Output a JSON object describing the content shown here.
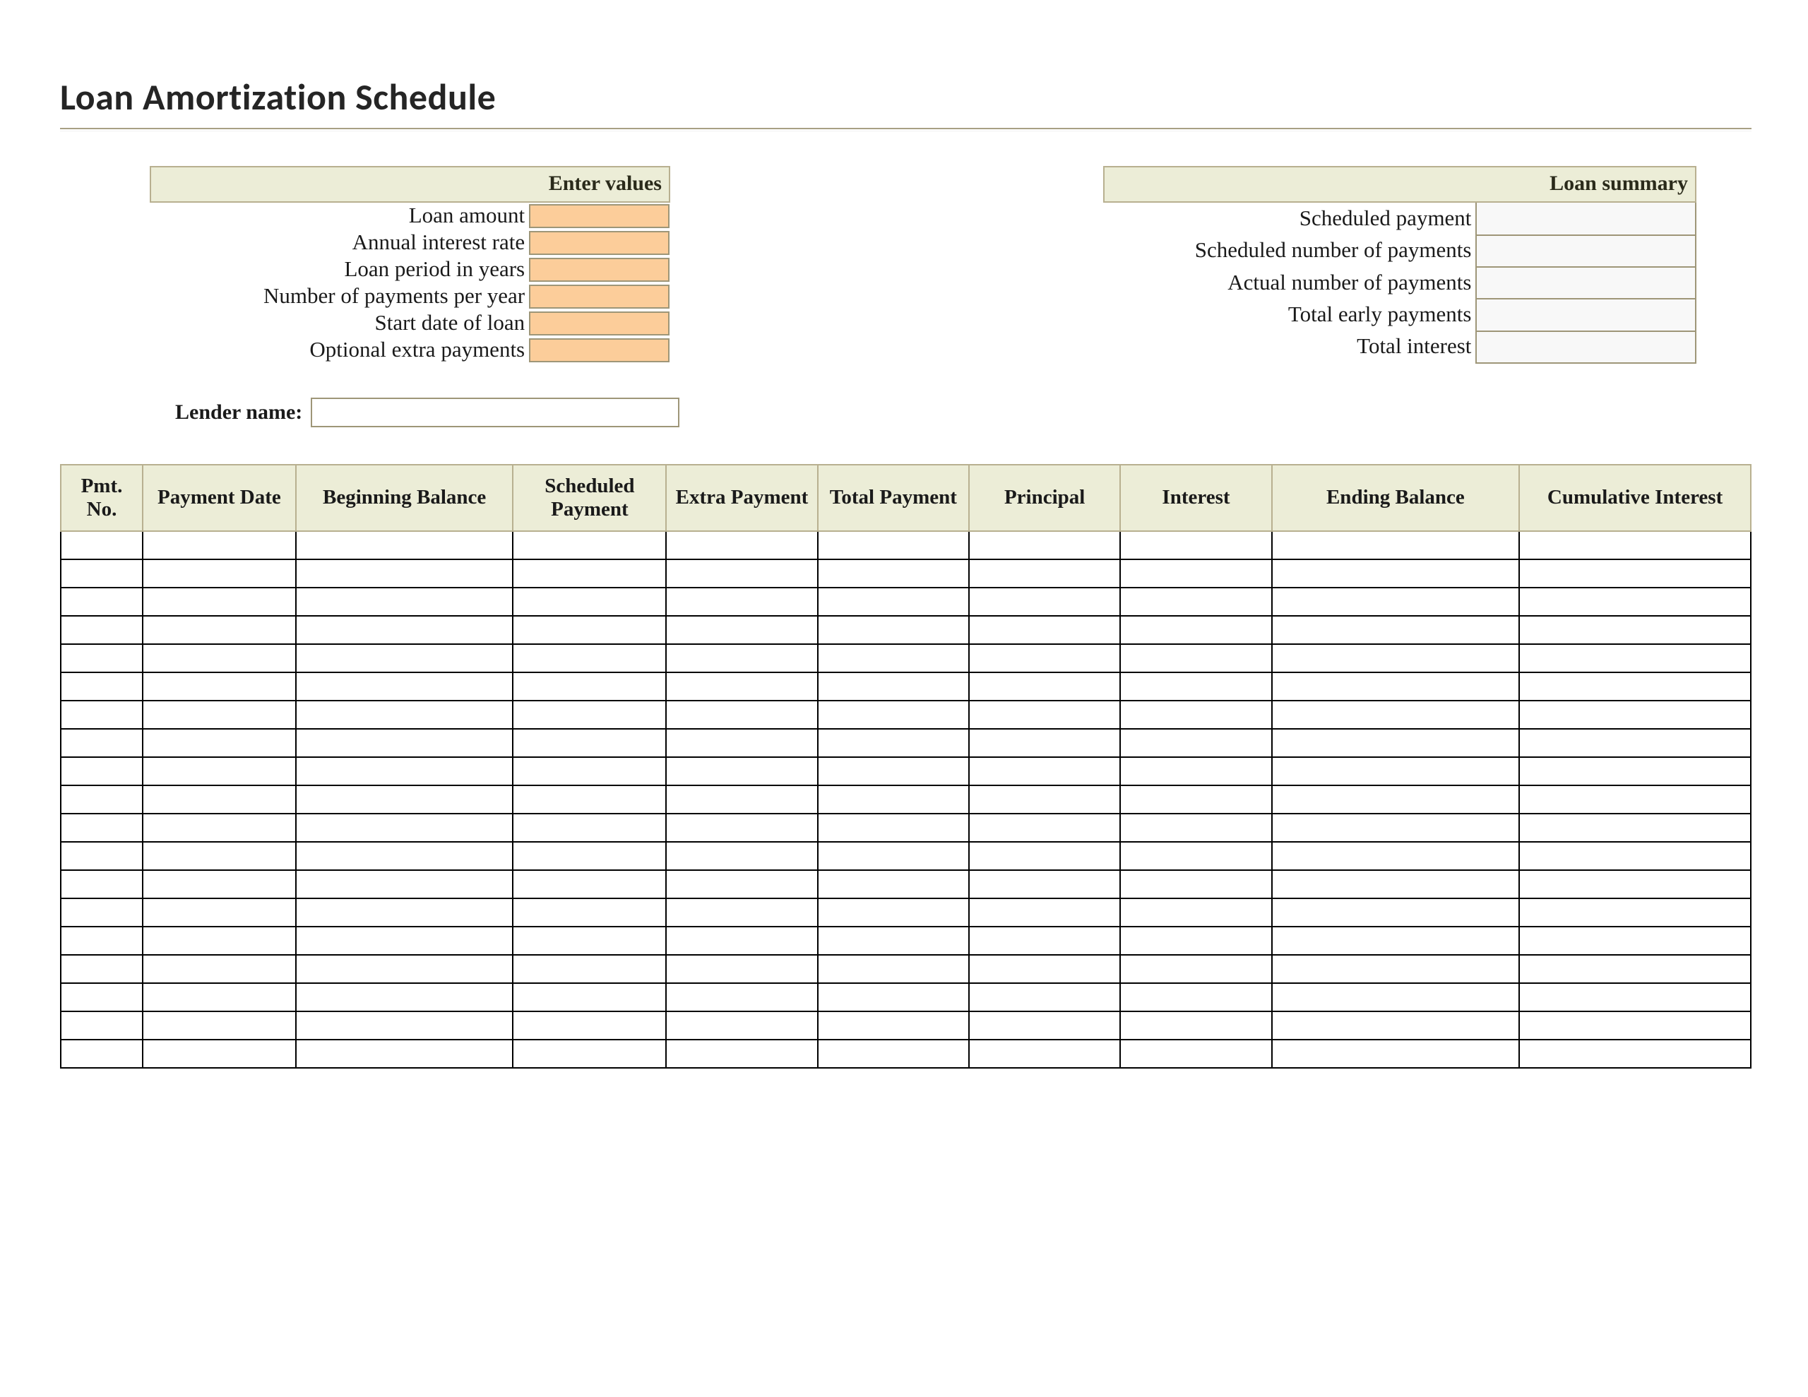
{
  "title": "Loan Amortization Schedule",
  "enter_values": {
    "header": "Enter values",
    "rows": [
      {
        "label": "Loan amount",
        "value": ""
      },
      {
        "label": "Annual interest rate",
        "value": ""
      },
      {
        "label": "Loan period in years",
        "value": ""
      },
      {
        "label": "Number of payments per year",
        "value": ""
      },
      {
        "label": "Start date of loan",
        "value": ""
      },
      {
        "label": "Optional extra payments",
        "value": ""
      }
    ]
  },
  "loan_summary": {
    "header": "Loan summary",
    "rows": [
      {
        "label": "Scheduled payment",
        "value": ""
      },
      {
        "label": "Scheduled number of payments",
        "value": ""
      },
      {
        "label": "Actual number of payments",
        "value": ""
      },
      {
        "label": "Total early payments",
        "value": ""
      },
      {
        "label": "Total interest",
        "value": ""
      }
    ]
  },
  "lender": {
    "label": "Lender name:",
    "value": ""
  },
  "schedule": {
    "columns": [
      "Pmt. No.",
      "Payment Date",
      "Beginning Balance",
      "Scheduled Payment",
      "Extra Payment",
      "Total Payment",
      "Principal",
      "Interest",
      "Ending Balance",
      "Cumulative Interest"
    ],
    "row_count": 19
  },
  "colors": {
    "header_bg": "#ecedd7",
    "input_bg": "#fccd9a",
    "summary_bg": "#f8f8f8",
    "border_olive": "#b8b090",
    "border_dark": "#000000"
  }
}
